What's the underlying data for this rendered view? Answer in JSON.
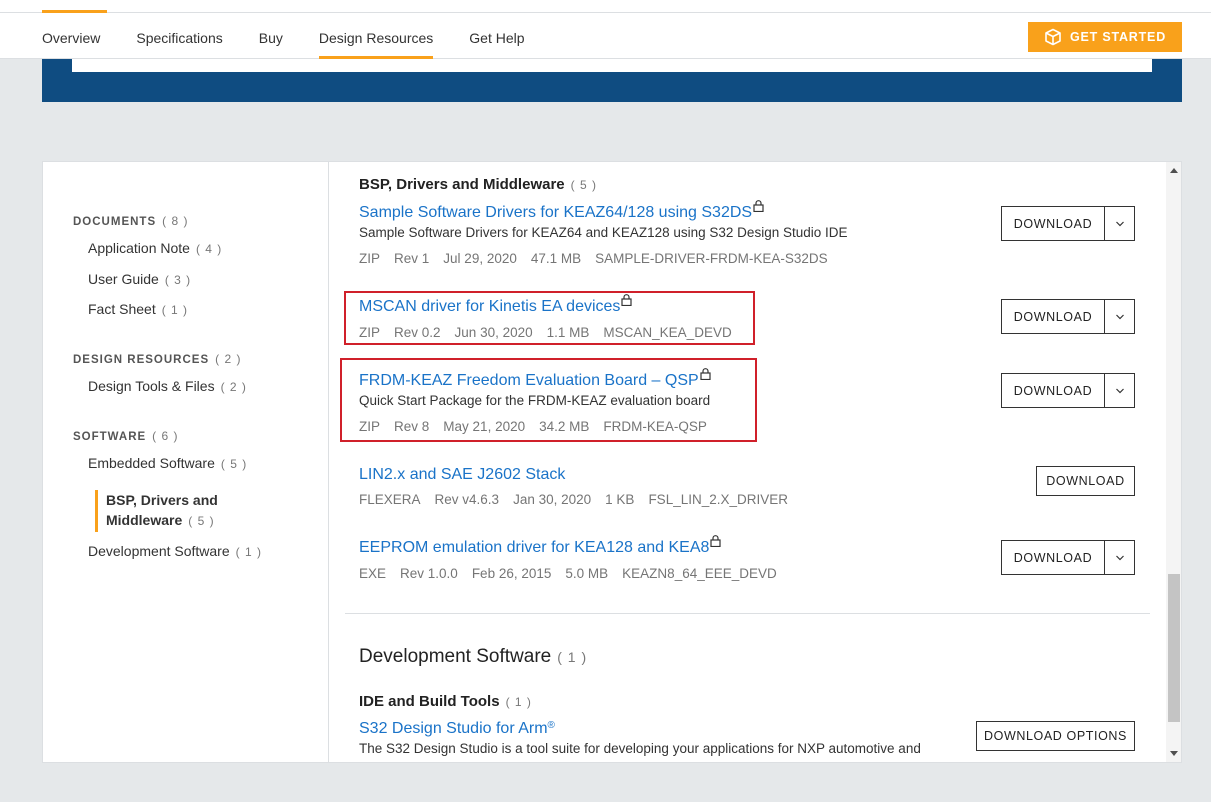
{
  "nav": {
    "tabs": [
      {
        "label": "Overview"
      },
      {
        "label": "Specifications"
      },
      {
        "label": "Buy"
      },
      {
        "label": "Design Resources"
      },
      {
        "label": "Get Help"
      }
    ],
    "active_tab": "Design Resources",
    "get_started": "GET STARTED"
  },
  "sidebar": {
    "documents": {
      "label": "DOCUMENTS",
      "count": "( 8 )"
    },
    "application_note": {
      "label": "Application Note",
      "count": "( 4 )"
    },
    "user_guide": {
      "label": "User Guide",
      "count": "( 3 )"
    },
    "fact_sheet": {
      "label": "Fact Sheet",
      "count": "( 1 )"
    },
    "design_resources": {
      "label": "DESIGN RESOURCES",
      "count": "( 2 )"
    },
    "design_tools": {
      "label": "Design Tools & Files",
      "count": "( 2 )"
    },
    "software": {
      "label": "SOFTWARE",
      "count": "( 6 )"
    },
    "embedded_software": {
      "label": "Embedded Software",
      "count": "( 5 )"
    },
    "bsp_line1": "BSP, Drivers and",
    "bsp_line2": "Middleware",
    "bsp_count": "( 5 )",
    "development_software": {
      "label": "Development Software",
      "count": "( 1 )"
    }
  },
  "content": {
    "bsp_section": {
      "title": "BSP, Drivers and Middleware",
      "count": "( 5 )"
    },
    "resources": [
      {
        "title": "Sample Software Drivers for KEAZ64/128 using S32DS",
        "desc": "Sample Software Drivers for KEAZ64 and KEAZ128 using S32 Design Studio IDE",
        "meta": [
          "ZIP",
          "Rev 1",
          "Jul 29, 2020",
          "47.1 MB",
          "SAMPLE-DRIVER-FRDM-KEA-S32DS"
        ],
        "button": "DOWNLOAD"
      },
      {
        "title": "MSCAN driver for Kinetis EA devices",
        "meta": [
          "ZIP",
          "Rev 0.2",
          "Jun 30, 2020",
          "1.1 MB",
          "MSCAN_KEA_DEVD"
        ],
        "button": "DOWNLOAD"
      },
      {
        "title": "FRDM-KEAZ Freedom Evaluation Board – QSP",
        "desc": "Quick Start Package for the FRDM-KEAZ evaluation board",
        "meta": [
          "ZIP",
          "Rev 8",
          "May 21, 2020",
          "34.2 MB",
          "FRDM-KEA-QSP"
        ],
        "button": "DOWNLOAD"
      },
      {
        "title": "LIN2.x and SAE J2602 Stack",
        "meta": [
          "FLEXERA",
          "Rev v4.6.3",
          "Jan 30, 2020",
          "1 KB",
          "FSL_LIN_2.X_DRIVER"
        ],
        "button": "DOWNLOAD"
      },
      {
        "title": "EEPROM emulation driver for KEA128 and KEA8",
        "meta": [
          "EXE",
          "Rev 1.0.0",
          "Feb 26, 2015",
          "5.0 MB",
          "KEAZN8_64_EEE_DEVD"
        ],
        "button": "DOWNLOAD"
      }
    ],
    "dev_section": {
      "title": "Development Software",
      "count": "( 1 )"
    },
    "ide_section": {
      "title": "IDE and Build Tools",
      "count": "( 1 )"
    },
    "s32": {
      "title": "S32 Design Studio for Arm",
      "reg": "®",
      "desc": "The S32 Design Studio is a tool suite for developing your applications for NXP automotive and",
      "button": "DOWNLOAD OPTIONS"
    }
  }
}
